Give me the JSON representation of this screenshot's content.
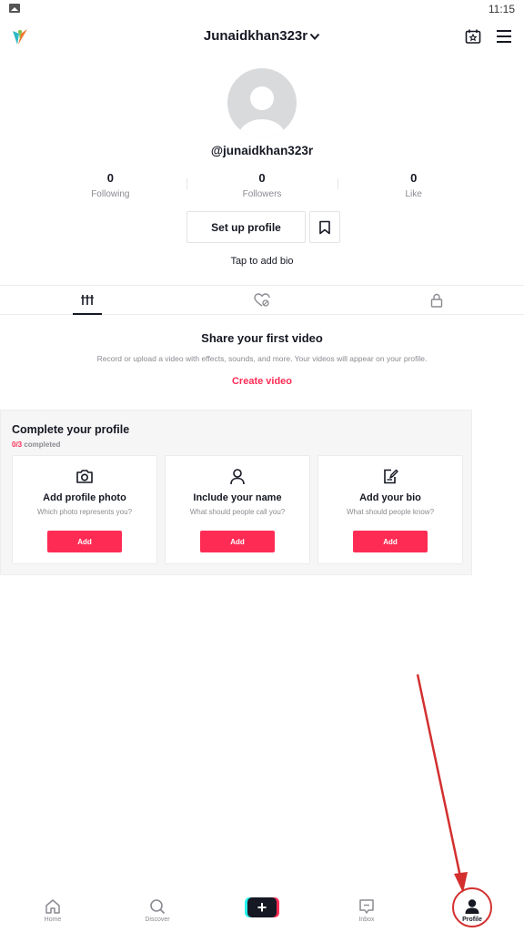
{
  "status_bar": {
    "time": "11:15"
  },
  "header": {
    "username": "Junaidkhan323r"
  },
  "profile": {
    "handle": "@junaidkhan323r",
    "stats": [
      {
        "value": "0",
        "label": "Following"
      },
      {
        "value": "0",
        "label": "Followers"
      },
      {
        "value": "0",
        "label": "Like"
      }
    ],
    "setup_button": "Set up profile",
    "bio_prompt": "Tap to add bio"
  },
  "empty_state": {
    "title": "Share your first video",
    "description": "Record or upload a video with effects, sounds, and more. Your videos will appear on your profile.",
    "cta": "Create video"
  },
  "complete_profile": {
    "title": "Complete your profile",
    "progress_done": "0/3",
    "progress_label": " completed",
    "cards": [
      {
        "icon": "camera-icon",
        "title": "Add profile photo",
        "subtitle": "Which photo represents you?",
        "button": "Add"
      },
      {
        "icon": "person-icon",
        "title": "Include your name",
        "subtitle": "What should people call you?",
        "button": "Add"
      },
      {
        "icon": "edit-bio-icon",
        "title": "Add your bio",
        "subtitle": "What should people know?",
        "button": "Add"
      }
    ]
  },
  "bottom_nav": {
    "items": [
      {
        "label": "Home",
        "icon": "home-icon"
      },
      {
        "label": "Discover",
        "icon": "search-icon"
      },
      {
        "label": "Inbox",
        "icon": "inbox-icon"
      },
      {
        "label": "Profile",
        "icon": "profile-icon"
      }
    ],
    "create_label": "+"
  },
  "colors": {
    "accent": "#fe2c55",
    "text": "#161823",
    "muted": "#8a8b91",
    "annotation": "#d32f2f"
  }
}
